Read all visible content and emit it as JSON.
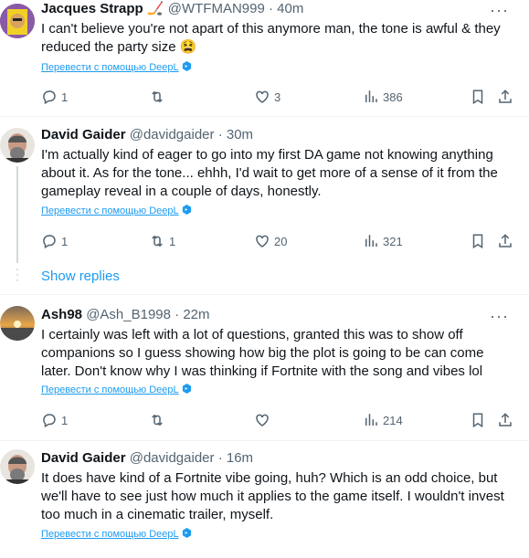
{
  "tweets": [
    {
      "name": "Jacques Strapp",
      "emoji": "🏒",
      "handle": "@WTFMAN999",
      "time": "40m",
      "body": "I can't believe you're not apart of this anymore man, the tone is awful & they reduced the party size 😫",
      "translate": "Перевести с помощью DeepL",
      "replies": "1",
      "retweets": "",
      "likes": "3",
      "views": "386"
    },
    {
      "name": "David Gaider",
      "handle": "@davidgaider",
      "time": "30m",
      "body": "I'm actually kind of eager to go into my first DA game not knowing anything about it. As for the tone... ehhh, I'd wait to get more of a sense of it from the gameplay reveal in a couple of days, honestly.",
      "translate": "Перевести с помощью DeepL",
      "replies": "1",
      "retweets": "1",
      "likes": "20",
      "views": "321"
    },
    {
      "name": "Ash98",
      "handle": "@Ash_B1998",
      "time": "22m",
      "body": "I certainly was left with a lot of questions, granted this was to show off companions so I guess showing how big the plot is going to be can come later. Don't know why I was thinking if Fortnite with the song and vibes lol",
      "translate": "Перевести с помощью DeepL",
      "replies": "1",
      "retweets": "",
      "likes": "",
      "views": "214"
    },
    {
      "name": "David Gaider",
      "handle": "@davidgaider",
      "time": "16m",
      "body": "It does have kind of a Fortnite vibe going, huh? Which is an odd choice, but we'll have to see just how much it applies to the game itself. I wouldn't invest too much in a cinematic trailer, myself.",
      "translate": "Перевести с помощью DeepL"
    }
  ],
  "show_replies": "Show replies",
  "dot": "·",
  "more": "···"
}
